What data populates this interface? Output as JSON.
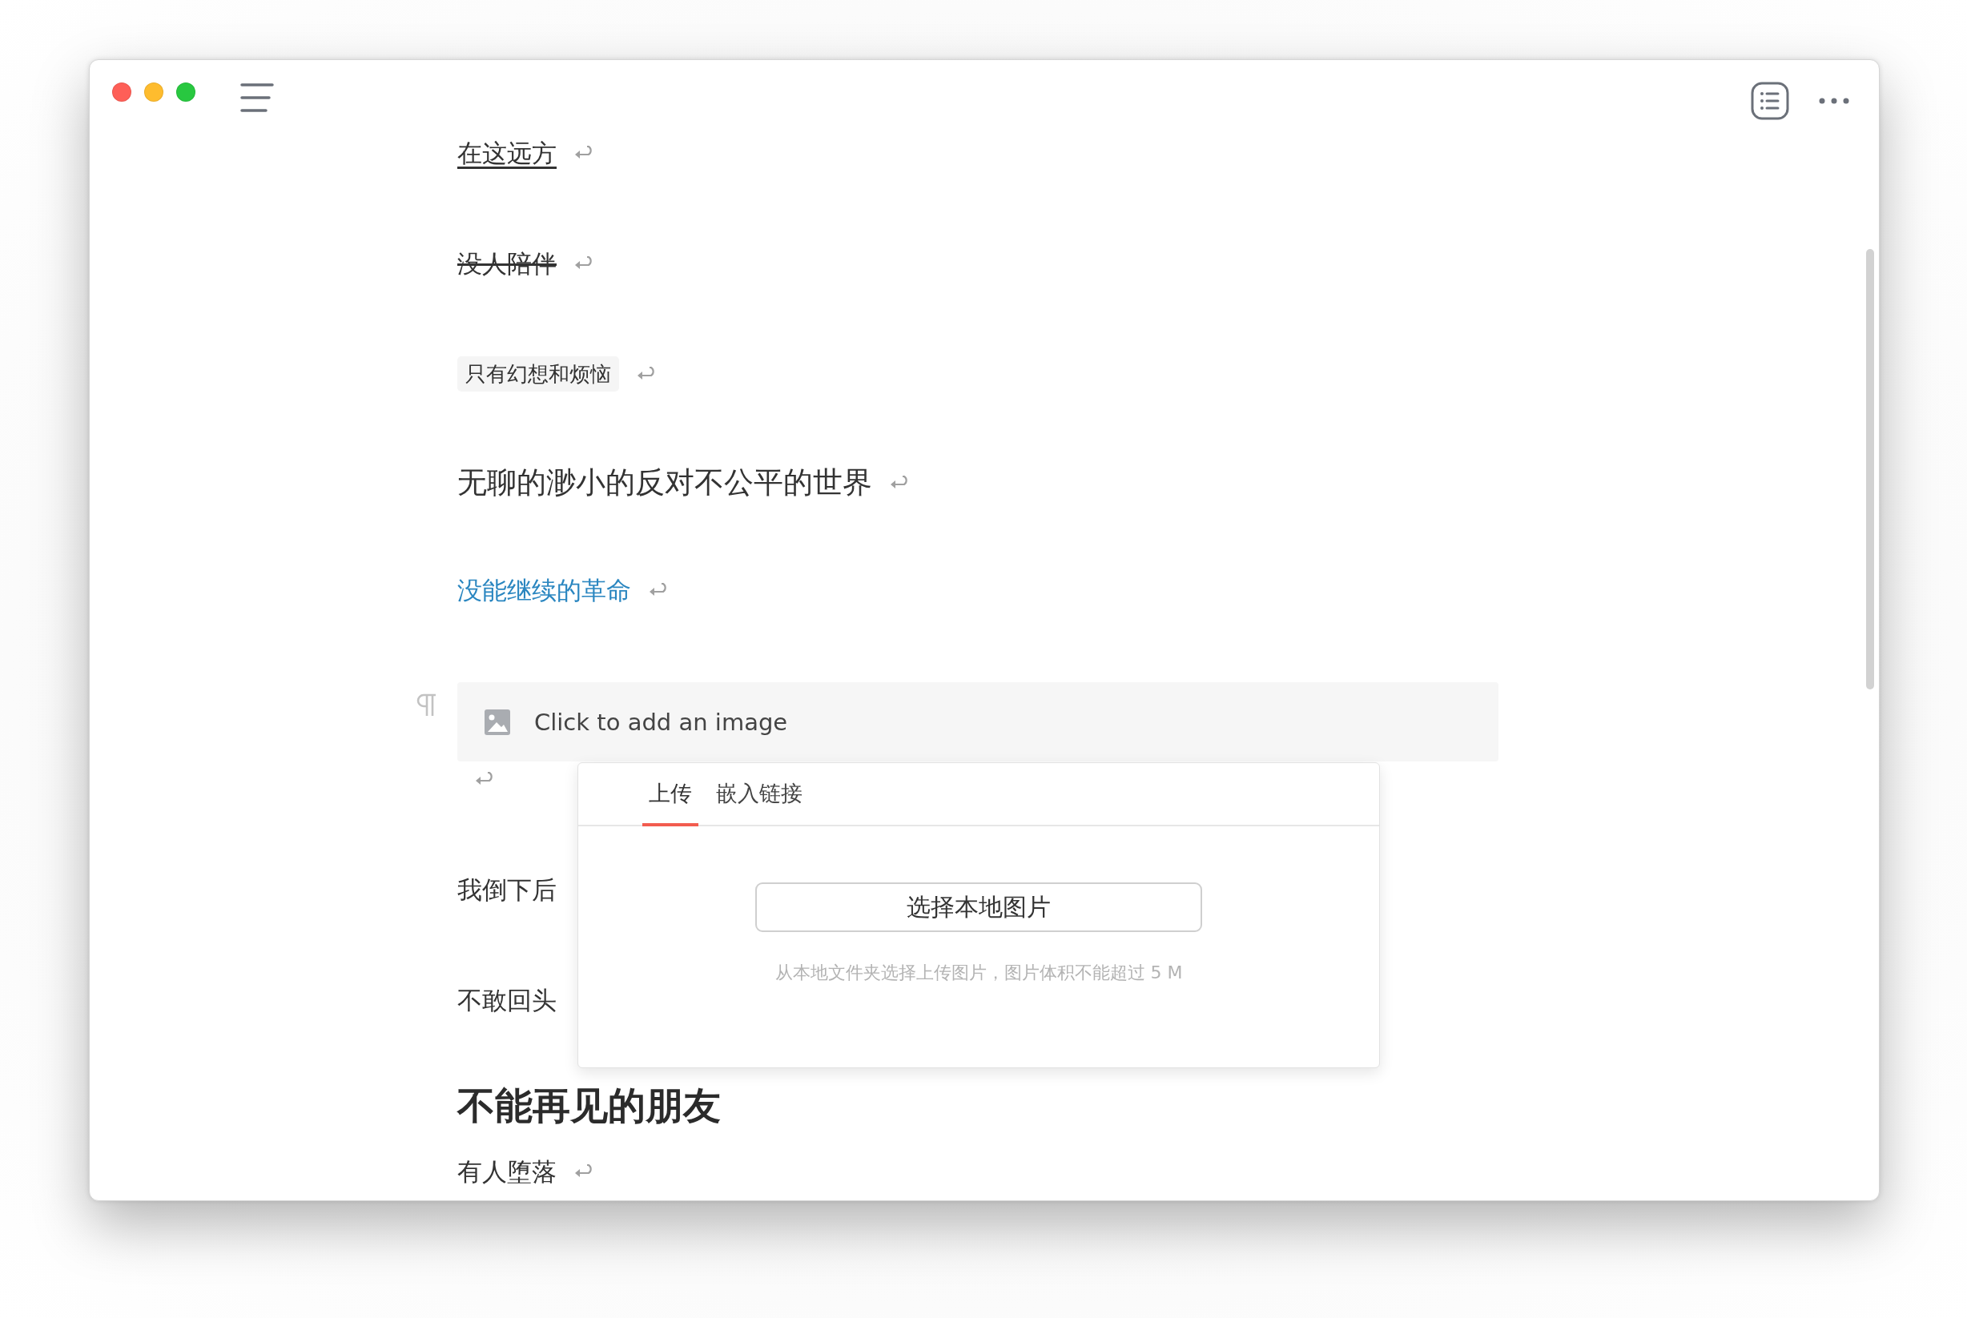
{
  "document": {
    "blocks": [
      {
        "kind": "underlined",
        "text": "在这远方",
        "return_mark": true
      },
      {
        "kind": "struck",
        "text": "没人陪伴",
        "return_mark": true
      },
      {
        "kind": "code",
        "text": "只有幻想和烦恼",
        "return_mark": true
      },
      {
        "kind": "large",
        "text": "无聊的渺小的反对不公平的世界",
        "return_mark": true
      },
      {
        "kind": "link",
        "text": "没能继续的革命",
        "return_mark": true
      },
      {
        "kind": "image",
        "prompt": "Click to add an image",
        "return_mark": true
      },
      {
        "kind": "paragraph",
        "text": "我倒下后",
        "return_mark": false
      },
      {
        "kind": "paragraph",
        "text": "不敢回头",
        "return_mark": false
      },
      {
        "kind": "heading",
        "text": "不能再见的朋友"
      },
      {
        "kind": "paragraph",
        "text": "有人堕落",
        "return_mark": true
      }
    ]
  },
  "image_popup": {
    "tabs": [
      {
        "label": "上传",
        "selected": true
      },
      {
        "label": "嵌入链接",
        "selected": false
      }
    ],
    "button": "选择本地图片",
    "hint": "从本地文件夹选择上传图片，图片体积不能超过 5 M"
  }
}
